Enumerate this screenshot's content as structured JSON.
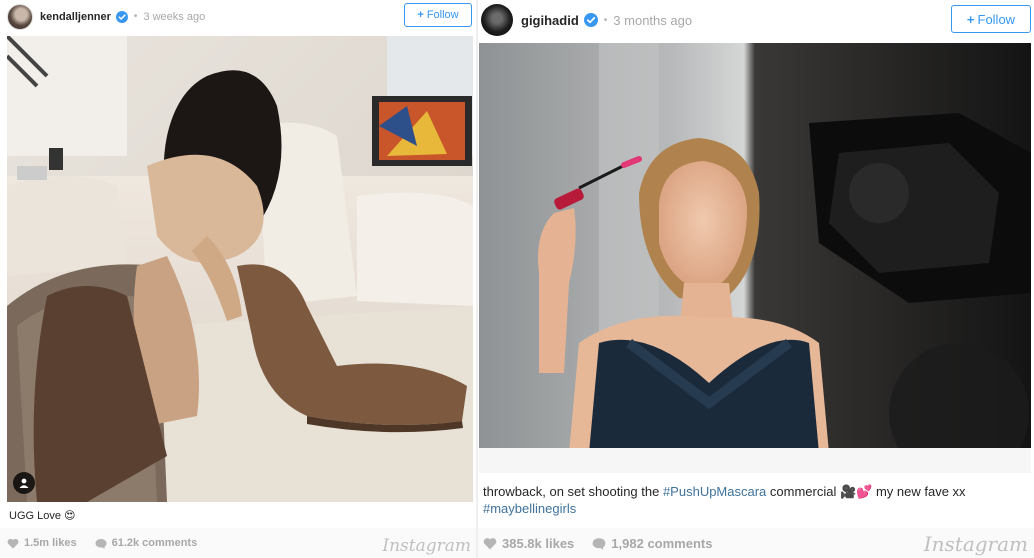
{
  "posts": [
    {
      "username": "kendalljenner",
      "verified": true,
      "time_ago": "3 weeks ago",
      "follow_label": "Follow",
      "caption_text": "UGG Love",
      "caption_emoji": "😍",
      "likes": "1.5m likes",
      "comments": "61.2k comments",
      "brand": "Instagram"
    },
    {
      "username": "gigihadid",
      "verified": true,
      "time_ago": "3 months ago",
      "follow_label": "Follow",
      "caption_prefix": "throwback, on set shooting the ",
      "caption_hashtag1": "#PushUpMascara",
      "caption_middle": " commercial ",
      "caption_emoji": "🎥💕",
      "caption_suffix": " my new fave xx",
      "caption_hashtag2": "#maybellinegirls",
      "likes": "385.8k likes",
      "comments": "1,982 comments",
      "brand": "Instagram"
    }
  ],
  "colors": {
    "accent": "#3897f0",
    "hashtag": "#3f729b",
    "muted": "#a8a8a8"
  }
}
